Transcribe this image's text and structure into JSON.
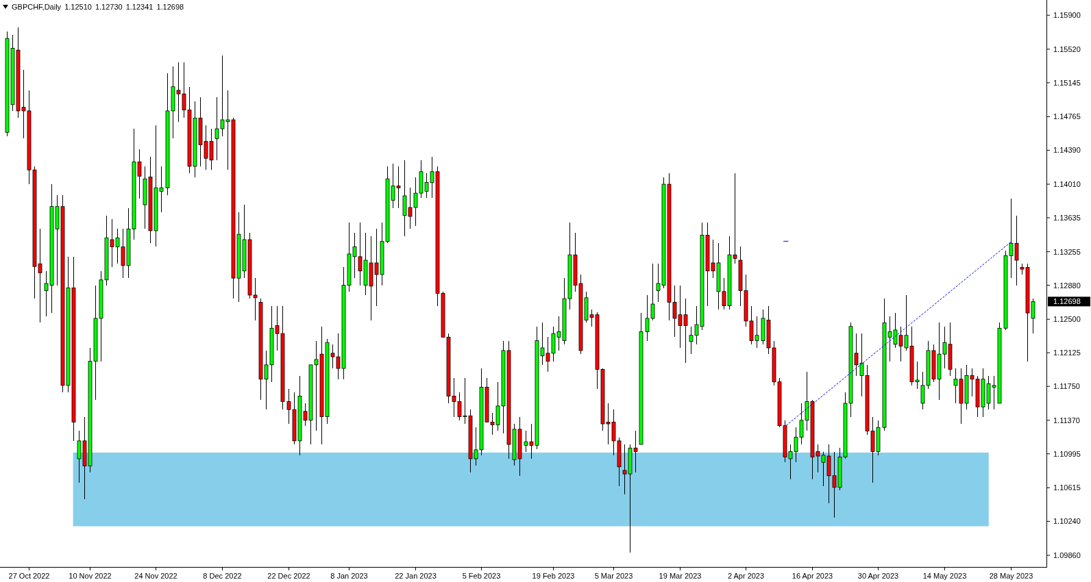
{
  "header": {
    "symbol": "GBPCHF,Daily",
    "quotes": [
      "1.12510",
      "1.12730",
      "1.12341",
      "1.12698"
    ]
  },
  "chart": {
    "price_tag": "1.12698",
    "chart_data": {
      "type": "candlestick",
      "ylim": [
        1.0973,
        1.1607
      ],
      "yticks": [
        {
          "value": 1.159,
          "label": "1.15900"
        },
        {
          "value": 1.1552,
          "label": "1.15520"
        },
        {
          "value": 1.15145,
          "label": "1.15145"
        },
        {
          "value": 1.14765,
          "label": "1.14765"
        },
        {
          "value": 1.1439,
          "label": "1.14390"
        },
        {
          "value": 1.1401,
          "label": "1.14010"
        },
        {
          "value": 1.13635,
          "label": "1.13635"
        },
        {
          "value": 1.13255,
          "label": "1.13255"
        },
        {
          "value": 1.1288,
          "label": "1.12880"
        },
        {
          "value": 1.125,
          "label": "1.12500"
        },
        {
          "value": 1.12125,
          "label": "1.12125"
        },
        {
          "value": 1.1175,
          "label": "1.11750"
        },
        {
          "value": 1.1137,
          "label": "1.11370"
        },
        {
          "value": 1.10995,
          "label": "1.10995"
        },
        {
          "value": 1.10615,
          "label": "1.10615"
        },
        {
          "value": 1.1024,
          "label": "1.10240"
        },
        {
          "value": 1.0986,
          "label": "1.09860"
        }
      ],
      "categories": [
        null,
        null,
        null,
        null,
        "27 Oct 2022",
        null,
        null,
        null,
        null,
        null,
        null,
        null,
        null,
        null,
        null,
        "10 Nov 2022",
        null,
        null,
        null,
        null,
        null,
        null,
        null,
        null,
        null,
        null,
        null,
        "24 Nov 2022",
        null,
        null,
        null,
        null,
        null,
        null,
        null,
        null,
        null,
        null,
        null,
        "8 Dec 2022",
        null,
        null,
        null,
        null,
        null,
        null,
        null,
        null,
        null,
        null,
        null,
        "22 Dec 2022",
        null,
        null,
        null,
        null,
        null,
        null,
        null,
        null,
        null,
        null,
        "8 Jan 2023",
        null,
        null,
        null,
        null,
        null,
        null,
        null,
        null,
        null,
        null,
        null,
        "22 Jan 2023",
        null,
        null,
        null,
        null,
        null,
        null,
        null,
        null,
        null,
        null,
        null,
        "5 Feb 2023",
        null,
        null,
        null,
        null,
        null,
        null,
        null,
        null,
        null,
        null,
        null,
        null,
        "19 Feb 2023",
        null,
        null,
        null,
        null,
        null,
        null,
        null,
        null,
        null,
        null,
        "5 Mar 2023",
        null,
        null,
        null,
        null,
        null,
        null,
        null,
        null,
        null,
        null,
        null,
        "19 Mar 2023",
        null,
        null,
        null,
        null,
        null,
        null,
        null,
        null,
        null,
        null,
        null,
        "2 Apr 2023",
        null,
        null,
        null,
        null,
        null,
        null,
        null,
        null,
        null,
        null,
        null,
        "16 Apr 2023",
        null,
        null,
        null,
        null,
        null,
        null,
        null,
        null,
        null,
        null,
        null,
        "30 Apr 2023",
        null,
        null,
        null,
        null,
        null,
        null,
        null,
        null,
        null,
        null,
        null,
        "14 May 2023",
        null,
        null,
        null,
        null,
        null,
        null,
        null,
        null,
        null,
        null,
        null,
        "28 May 2023",
        null,
        null,
        null,
        null
      ],
      "ohlc": [
        [
          1.1459,
          1.1572,
          1.1455,
          1.1564
        ],
        [
          1.149,
          1.1568,
          1.1483,
          1.1553
        ],
        [
          1.1551,
          1.1576,
          1.1475,
          1.1483
        ],
        [
          1.1487,
          1.1529,
          1.1452,
          1.1483
        ],
        [
          1.1483,
          1.1506,
          1.1401,
          1.1417
        ],
        [
          1.1417,
          1.1421,
          1.1273,
          1.1309
        ],
        [
          1.1312,
          1.1351,
          1.1246,
          1.1302
        ],
        [
          1.1282,
          1.1304,
          1.1253,
          1.129
        ],
        [
          1.1288,
          1.1401,
          1.1257,
          1.1376
        ],
        [
          1.1351,
          1.1389,
          1.1288,
          1.1376
        ],
        [
          1.1376,
          1.1389,
          1.1168,
          1.1176
        ],
        [
          1.1176,
          1.132,
          1.1168,
          1.1285
        ],
        [
          1.1285,
          1.132,
          1.1114,
          1.1135
        ],
        [
          1.1094,
          1.1125,
          1.1067,
          1.1114
        ],
        [
          1.1114,
          1.1141,
          1.1049,
          1.1086
        ],
        [
          1.1086,
          1.1218,
          1.1079,
          1.1203
        ],
        [
          1.1203,
          1.1288,
          1.116,
          1.1251
        ],
        [
          1.1251,
          1.1304,
          1.1203,
          1.1294
        ],
        [
          1.1294,
          1.1366,
          1.1288,
          1.1341
        ],
        [
          1.1339,
          1.1362,
          1.1308,
          1.1331
        ],
        [
          1.1331,
          1.1351,
          1.1312,
          1.1341
        ],
        [
          1.1331,
          1.1351,
          1.1296,
          1.131
        ],
        [
          1.131,
          1.1374,
          1.1296,
          1.1351
        ],
        [
          1.1351,
          1.1463,
          1.1339,
          1.1426
        ],
        [
          1.1426,
          1.144,
          1.1385,
          1.141
        ],
        [
          1.1378,
          1.1421,
          1.1351,
          1.1407
        ],
        [
          1.1409,
          1.1432,
          1.1335,
          1.1349
        ],
        [
          1.1349,
          1.1467,
          1.1331,
          1.1397
        ],
        [
          1.1393,
          1.1421,
          1.137,
          1.1397
        ],
        [
          1.1397,
          1.1525,
          1.1389,
          1.1483
        ],
        [
          1.1483,
          1.1533,
          1.1452,
          1.151
        ],
        [
          1.1506,
          1.1537,
          1.1471,
          1.1502
        ],
        [
          1.1502,
          1.1537,
          1.1475,
          1.1484
        ],
        [
          1.1484,
          1.151,
          1.1413,
          1.1421
        ],
        [
          1.1421,
          1.1494,
          1.1409,
          1.1475
        ],
        [
          1.1475,
          1.1498,
          1.1421,
          1.1445
        ],
        [
          1.1449,
          1.1467,
          1.1417,
          1.143
        ],
        [
          1.1449,
          1.1463,
          1.1417,
          1.1428
        ],
        [
          1.1452,
          1.1498,
          1.1428,
          1.1463
        ],
        [
          1.1463,
          1.1545,
          1.1455,
          1.1473
        ],
        [
          1.1471,
          1.1506,
          1.1417,
          1.1473
        ],
        [
          1.1473,
          1.1475,
          1.1273,
          1.1296
        ],
        [
          1.1296,
          1.137,
          1.1269,
          1.1345
        ],
        [
          1.1304,
          1.1378,
          1.1296,
          1.1339
        ],
        [
          1.1339,
          1.1347,
          1.1273,
          1.1277
        ],
        [
          1.1277,
          1.1296,
          1.1249,
          1.1274
        ],
        [
          1.1269,
          1.1273,
          1.116,
          1.1183
        ],
        [
          1.1183,
          1.1215,
          1.1149,
          1.1199
        ],
        [
          1.1199,
          1.1265,
          1.118,
          1.124
        ],
        [
          1.1243,
          1.1265,
          1.1215,
          1.1234
        ],
        [
          1.1234,
          1.1265,
          1.1149,
          1.1158
        ],
        [
          1.1158,
          1.1172,
          1.1133,
          1.1149
        ],
        [
          1.1149,
          1.1168,
          1.111,
          1.1114
        ],
        [
          1.1114,
          1.1187,
          1.1098,
          1.1164
        ],
        [
          1.1147,
          1.1156,
          1.1131,
          1.1137
        ],
        [
          1.1137,
          1.1199,
          1.111,
          1.1199
        ],
        [
          1.1199,
          1.1226,
          1.1125,
          1.1205
        ],
        [
          1.1211,
          1.1242,
          1.111,
          1.1141
        ],
        [
          1.1141,
          1.1228,
          1.1133,
          1.1224
        ],
        [
          1.1212,
          1.1222,
          1.1195,
          1.1208
        ],
        [
          1.1208,
          1.1234,
          1.1183,
          1.1195
        ],
        [
          1.1195,
          1.1308,
          1.1183,
          1.1288
        ],
        [
          1.1288,
          1.1358,
          1.1281,
          1.1323
        ],
        [
          1.132,
          1.1347,
          1.1296,
          1.1331
        ],
        [
          1.132,
          1.1358,
          1.1288,
          1.1304
        ],
        [
          1.1288,
          1.1347,
          1.1277,
          1.1316
        ],
        [
          1.1313,
          1.1343,
          1.1249,
          1.1287
        ],
        [
          1.1313,
          1.1351,
          1.1265,
          1.13
        ],
        [
          1.13,
          1.1358,
          1.1288,
          1.1337
        ],
        [
          1.1337,
          1.1421,
          1.1335,
          1.1407
        ],
        [
          1.1383,
          1.1424,
          1.1374,
          1.1399
        ],
        [
          1.1399,
          1.1421,
          1.1374,
          1.1397
        ],
        [
          1.1366,
          1.1428,
          1.1343,
          1.1388
        ],
        [
          1.1375,
          1.1397,
          1.1351,
          1.1365
        ],
        [
          1.1375,
          1.1409,
          1.1354,
          1.1391
        ],
        [
          1.1391,
          1.1428,
          1.1386,
          1.1415
        ],
        [
          1.1393,
          1.1413,
          1.1386,
          1.1403
        ],
        [
          1.1403,
          1.1432,
          1.1386,
          1.1415
        ],
        [
          1.1415,
          1.1421,
          1.1265,
          1.1279
        ],
        [
          1.1279,
          1.1281,
          1.123,
          1.123
        ],
        [
          1.123,
          1.1234,
          1.1156,
          1.1164
        ],
        [
          1.1164,
          1.1184,
          1.1141,
          1.1158
        ],
        [
          1.1158,
          1.1168,
          1.1137,
          1.1141
        ],
        [
          1.1141,
          1.1184,
          1.1133,
          1.1142
        ],
        [
          1.1142,
          1.1149,
          1.1079,
          1.1094
        ],
        [
          1.1094,
          1.1129,
          1.1086,
          1.1104
        ],
        [
          1.1104,
          1.1195,
          1.1098,
          1.1174
        ],
        [
          1.1174,
          1.1184,
          1.1135,
          1.1135
        ],
        [
          1.1135,
          1.1145,
          1.1121,
          1.1132
        ],
        [
          1.1132,
          1.118,
          1.1125,
          1.1153
        ],
        [
          1.1153,
          1.1226,
          1.1122,
          1.1215
        ],
        [
          1.1215,
          1.1226,
          1.1094,
          1.111
        ],
        [
          1.1093,
          1.1133,
          1.1086,
          1.1127
        ],
        [
          1.1127,
          1.1141,
          1.1075,
          1.1094
        ],
        [
          1.1109,
          1.1125,
          1.1102,
          1.1113
        ],
        [
          1.1113,
          1.1133,
          1.1094,
          1.1109
        ],
        [
          1.1109,
          1.1242,
          1.1105,
          1.1226
        ],
        [
          1.1209,
          1.1246,
          1.1199,
          1.1218
        ],
        [
          1.1212,
          1.123,
          1.1191,
          1.1203
        ],
        [
          1.1212,
          1.1242,
          1.1203,
          1.1234
        ],
        [
          1.123,
          1.1253,
          1.1215,
          1.1236
        ],
        [
          1.1226,
          1.1296,
          1.1222,
          1.1273
        ],
        [
          1.1273,
          1.1358,
          1.1261,
          1.1322
        ],
        [
          1.1322,
          1.1347,
          1.1281,
          1.1288
        ],
        [
          1.129,
          1.13,
          1.1211,
          1.1215
        ],
        [
          1.1249,
          1.1281,
          1.1246,
          1.1274
        ],
        [
          1.1255,
          1.1261,
          1.1242,
          1.1252
        ],
        [
          1.1255,
          1.1258,
          1.1172,
          1.1194
        ],
        [
          1.1194,
          1.1195,
          1.1125,
          1.1133
        ],
        [
          1.1135,
          1.1156,
          1.111,
          1.1133
        ],
        [
          1.1135,
          1.1149,
          1.1098,
          1.1114
        ],
        [
          1.1114,
          1.1118,
          1.1063,
          1.1085
        ],
        [
          1.1081,
          1.111,
          1.1054,
          1.1077
        ],
        [
          1.1077,
          1.111,
          1.0989,
          1.1106
        ],
        [
          1.1106,
          1.1125,
          1.1079,
          1.1102
        ],
        [
          1.111,
          1.1257,
          1.111,
          1.1236
        ],
        [
          1.1236,
          1.1277,
          1.1226,
          1.1251
        ],
        [
          1.1251,
          1.1312,
          1.1249,
          1.1267
        ],
        [
          1.1282,
          1.1312,
          1.1269,
          1.129
        ],
        [
          1.1288,
          1.1409,
          1.1285,
          1.1401
        ],
        [
          1.1401,
          1.1413,
          1.1249,
          1.1269
        ],
        [
          1.1269,
          1.1288,
          1.123,
          1.1251
        ],
        [
          1.1255,
          1.1288,
          1.1218,
          1.1243
        ],
        [
          1.1255,
          1.1273,
          1.1201,
          1.1243
        ],
        [
          1.1225,
          1.1242,
          1.1211,
          1.1232
        ],
        [
          1.1232,
          1.1265,
          1.1222,
          1.1244
        ],
        [
          1.1242,
          1.1358,
          1.1238,
          1.1344
        ],
        [
          1.1344,
          1.1358,
          1.1265,
          1.1304
        ],
        [
          1.1313,
          1.1339,
          1.1296,
          1.1304
        ],
        [
          1.1281,
          1.1335,
          1.1261,
          1.1313
        ],
        [
          1.1281,
          1.1296,
          1.1261,
          1.1265
        ],
        [
          1.1265,
          1.1343,
          1.1261,
          1.1322
        ],
        [
          1.1322,
          1.1413,
          1.1312,
          1.1318
        ],
        [
          1.1316,
          1.1331,
          1.1265,
          1.1282
        ],
        [
          1.1282,
          1.13,
          1.1242,
          1.1248
        ],
        [
          1.1248,
          1.1265,
          1.1222,
          1.1226
        ],
        [
          1.1226,
          1.1253,
          1.1218,
          1.1232
        ],
        [
          1.1226,
          1.1261,
          1.1222,
          1.1251
        ],
        [
          1.1249,
          1.1265,
          1.1211,
          1.1218
        ],
        [
          1.1218,
          1.1226,
          1.1176,
          1.118
        ],
        [
          1.118,
          1.1184,
          1.1129,
          1.1131
        ],
        [
          1.1131,
          1.1137,
          1.109,
          1.1096
        ],
        [
          1.1094,
          1.111,
          1.1071,
          1.1102
        ],
        [
          1.1102,
          1.1129,
          1.109,
          1.1118
        ],
        [
          1.1118,
          1.1156,
          1.111,
          1.1137
        ],
        [
          1.1137,
          1.1191,
          1.1125,
          1.1158
        ],
        [
          1.1158,
          1.116,
          1.1071,
          1.1096
        ],
        [
          1.1102,
          1.111,
          1.1079,
          1.1097
        ],
        [
          1.109,
          1.1102,
          1.1063,
          1.1098
        ],
        [
          1.1097,
          1.111,
          1.1044,
          1.1075
        ],
        [
          1.1075,
          1.1102,
          1.1028,
          1.1062
        ],
        [
          1.1062,
          1.1106,
          1.1059,
          1.1096
        ],
        [
          1.1096,
          1.1168,
          1.1094,
          1.1156
        ],
        [
          1.1156,
          1.1246,
          1.1141,
          1.1242
        ],
        [
          1.1212,
          1.1234,
          1.1187,
          1.1199
        ],
        [
          1.1187,
          1.1234,
          1.1164,
          1.1201
        ],
        [
          1.1187,
          1.1199,
          1.1121,
          1.1125
        ],
        [
          1.1125,
          1.1141,
          1.1067,
          1.1102
        ],
        [
          1.1102,
          1.1137,
          1.1098,
          1.1129
        ],
        [
          1.1129,
          1.1273,
          1.1125,
          1.1246
        ],
        [
          1.123,
          1.1253,
          1.1203,
          1.1236
        ],
        [
          1.1222,
          1.1257,
          1.1218,
          1.1238
        ],
        [
          1.1232,
          1.1242,
          1.1203,
          1.122
        ],
        [
          1.1218,
          1.1277,
          1.1215,
          1.1232
        ],
        [
          1.122,
          1.1242,
          1.1176,
          1.118
        ],
        [
          1.118,
          1.1203,
          1.1172,
          1.1182
        ],
        [
          1.1156,
          1.1191,
          1.1149,
          1.1176
        ],
        [
          1.1176,
          1.1226,
          1.1172,
          1.1215
        ],
        [
          1.1215,
          1.1222,
          1.118,
          1.1183
        ],
        [
          1.1183,
          1.1246,
          1.116,
          1.1211
        ],
        [
          1.1211,
          1.1242,
          1.1195,
          1.1224
        ],
        [
          1.1222,
          1.1246,
          1.1187,
          1.1194
        ],
        [
          1.1176,
          1.1195,
          1.1156,
          1.1183
        ],
        [
          1.1183,
          1.1195,
          1.1133,
          1.1156
        ],
        [
          1.1156,
          1.1199,
          1.1149,
          1.1187
        ],
        [
          1.1187,
          1.1195,
          1.1164,
          1.1183
        ],
        [
          1.1183,
          1.1187,
          1.1141,
          1.1152
        ],
        [
          1.1152,
          1.1195,
          1.1141,
          1.1183
        ],
        [
          1.1156,
          1.1187,
          1.1149,
          1.1178
        ],
        [
          1.1174,
          1.1187,
          1.1149,
          1.1176
        ],
        [
          1.1156,
          1.1246,
          1.1156,
          1.124
        ],
        [
          1.124,
          1.1327,
          1.1238,
          1.1321
        ],
        [
          1.1321,
          1.1385,
          1.1296,
          1.1335
        ],
        [
          1.1335,
          1.1366,
          1.1288,
          1.1316
        ],
        [
          1.1308,
          1.1312,
          1.13,
          1.1306
        ],
        [
          1.1308,
          1.1312,
          1.1203,
          1.1257
        ],
        [
          1.1251,
          1.1273,
          1.12341,
          1.12698
        ]
      ]
    }
  }
}
